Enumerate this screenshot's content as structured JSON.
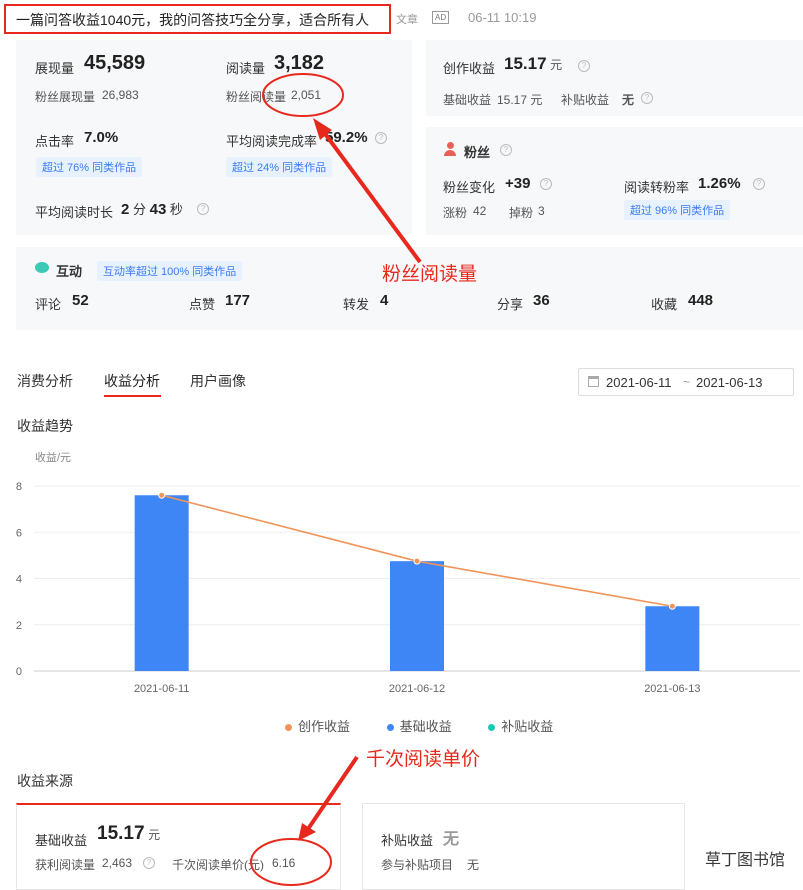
{
  "header": {
    "title": "一篇问答收益1040元，我的问答技巧全分享，适合所有人",
    "type": "文章",
    "ad": "AD",
    "time": "06-11 10:19"
  },
  "stats": {
    "impressions_label": "展现量",
    "impressions": "45,589",
    "fan_impressions_label": "粉丝展现量",
    "fan_impressions": "26,983",
    "reads_label": "阅读量",
    "reads": "3,182",
    "fan_reads_label": "粉丝阅读量",
    "fan_reads": "2,051",
    "ctr_label": "点击率",
    "ctr": "7.0%",
    "ctr_tag": "超过 76% 同类作品",
    "completion_label": "平均阅读完成率",
    "completion": "59.2%",
    "completion_tag": "超过 24% 同类作品",
    "avg_time_label": "平均阅读时长",
    "avg_time_min": "2",
    "min_unit": "分",
    "avg_time_sec": "43",
    "sec_unit": "秒"
  },
  "income": {
    "label": "创作收益",
    "value": "15.17",
    "unit": "元",
    "base_label": "基础收益",
    "base_value": "15.17 元",
    "subsidy_label": "补贴收益",
    "subsidy_value": "无"
  },
  "fans": {
    "title": "粉丝",
    "change_label": "粉丝变化",
    "change": "+39",
    "conv_label": "阅读转粉率",
    "conv": "1.26%",
    "conv_tag": "超过 96% 同类作品",
    "gain_label": "涨粉",
    "gain": "42",
    "loss_label": "掉粉",
    "loss": "3"
  },
  "interaction": {
    "title": "互动",
    "tag": "互动率超过 100% 同类作品",
    "items": [
      {
        "label": "评论",
        "value": "52"
      },
      {
        "label": "点赞",
        "value": "177"
      },
      {
        "label": "转发",
        "value": "4"
      },
      {
        "label": "分享",
        "value": "36"
      },
      {
        "label": "收藏",
        "value": "448"
      }
    ]
  },
  "tabs": [
    "消费分析",
    "收益分析",
    "用户画像"
  ],
  "date_range": {
    "start": "2021-06-11",
    "sep": "~",
    "end": "2021-06-13"
  },
  "trend_title": "收益趋势",
  "chart_data": {
    "type": "bar",
    "ylabel": "收益/元",
    "categories": [
      "2021-06-11",
      "2021-06-12",
      "2021-06-13"
    ],
    "ylim": [
      0,
      8
    ],
    "yticks": [
      0,
      2,
      4,
      6,
      8
    ],
    "series": [
      {
        "name": "创作收益",
        "kind": "line",
        "color": "#f0945a",
        "values": [
          7.6,
          4.75,
          2.8
        ]
      },
      {
        "name": "基础收益",
        "kind": "bar",
        "color": "#3e86f5",
        "values": [
          7.6,
          4.75,
          2.8
        ]
      },
      {
        "name": "补贴收益",
        "kind": "bar",
        "color": "#1cc9b5",
        "values": [
          0,
          0,
          0
        ]
      }
    ],
    "grid": true,
    "legend": "bottom"
  },
  "source": {
    "title": "收益来源",
    "base_label": "基础收益",
    "base_value": "15.17",
    "base_unit": "元",
    "reads_label": "获利阅读量",
    "reads_value": "2,463",
    "cpm_label": "千次阅读单价(元)",
    "cpm_value": "6.16",
    "subsidy_label": "补贴收益",
    "subsidy_value": "无",
    "subsidy_items_label": "参与补贴项目",
    "subsidy_items_value": "无"
  },
  "annotations": {
    "fan_reads": "粉丝阅读量",
    "cpm": "千次阅读单价"
  },
  "watermark": "草丁图书馆",
  "colors": {
    "accent": "#e8281d",
    "blue": "#3e86f5",
    "orange": "#f0945a",
    "teal": "#1cc9b5"
  }
}
